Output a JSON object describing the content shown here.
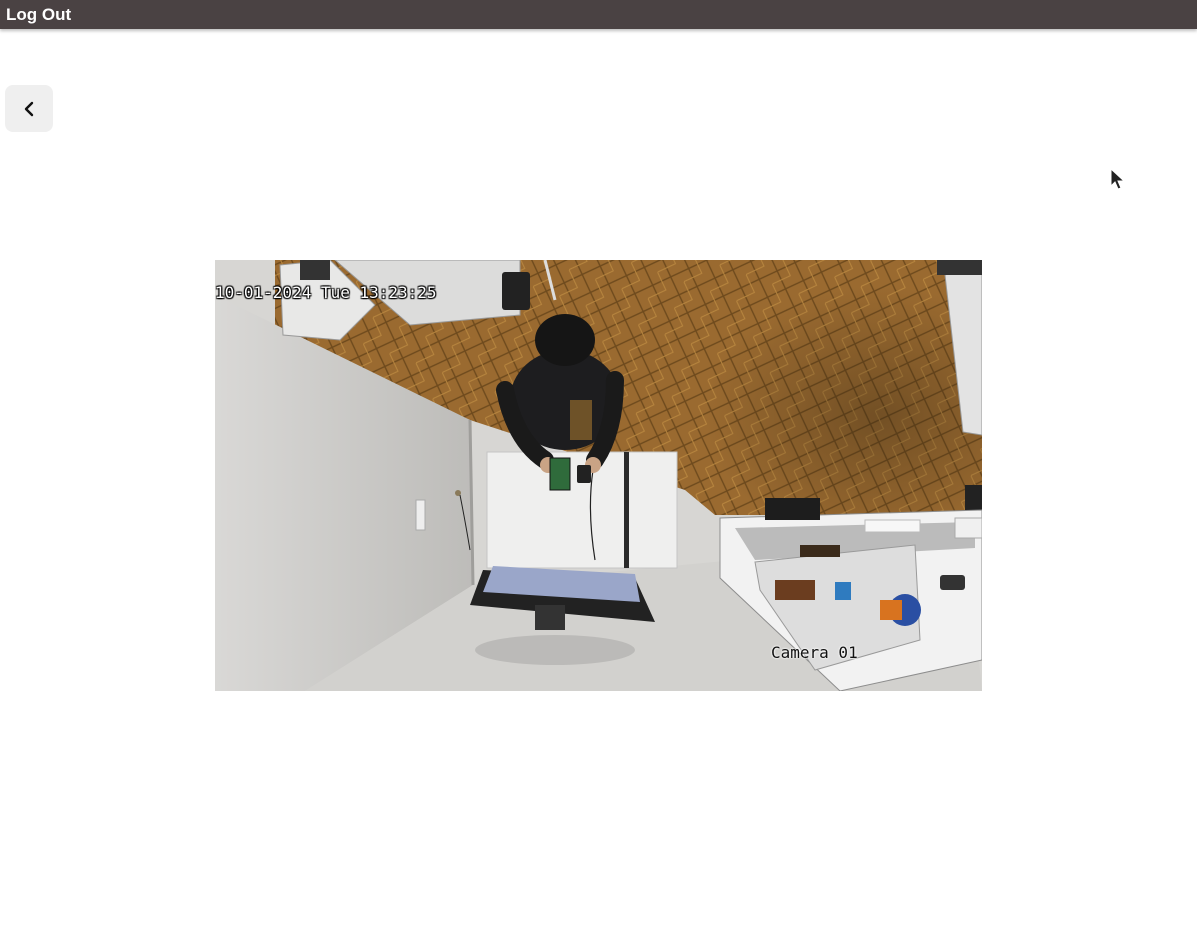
{
  "header": {
    "logout_label": "Log Out"
  },
  "nav": {
    "back_icon": "chevron-left-icon"
  },
  "video": {
    "timestamp": "10-01-2024 Tue 13:23:25",
    "camera_label": "Camera 01"
  },
  "colors": {
    "header_bg": "#4a4243",
    "back_button_bg": "#efefef",
    "floor": "#9b6a32"
  }
}
